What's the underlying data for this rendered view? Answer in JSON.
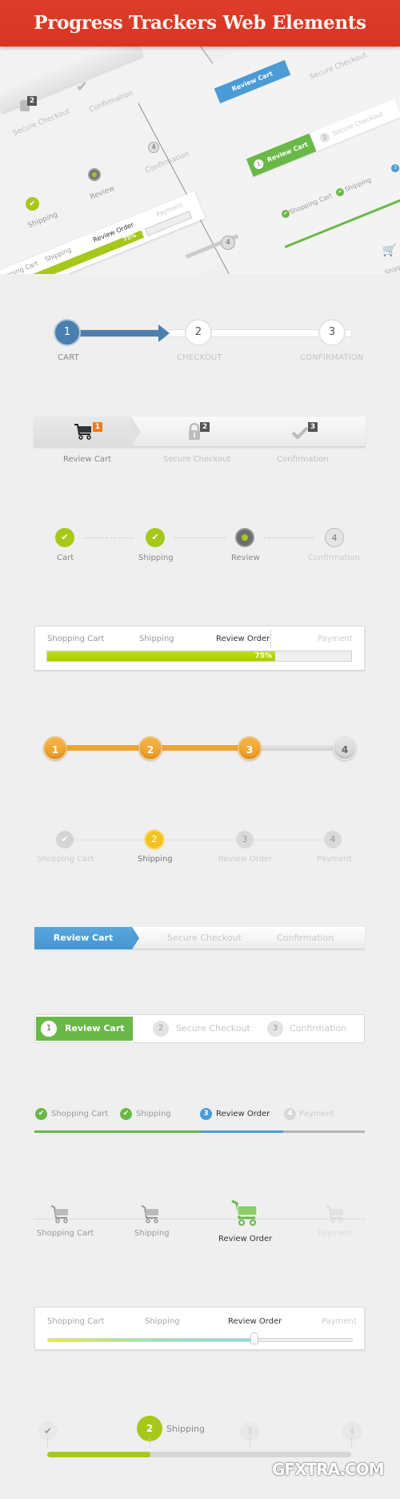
{
  "header": {
    "title": "Progress Trackers Web Elements"
  },
  "colors": {
    "header_red": "#d83424",
    "blue": "#4a7fb0",
    "lime": "#a6c81a",
    "orange": "#f0a22e",
    "yellow": "#f2c41f",
    "sky_blue": "#4a9bd6",
    "green": "#6ab848",
    "badge_orange": "#ef7d1a",
    "badge_dark": "#555555"
  },
  "hero": {
    "left_panel": {
      "secure_checkout": "Secure Checkout",
      "confirmation_top": "Confirmation",
      "confirmation": "Confirmation",
      "review": "Review",
      "shipping": "Shipping",
      "step4": "4",
      "badge2": "2",
      "bar_labels": [
        "Shopping Cart",
        "Shipping",
        "Review Order",
        "Payment"
      ],
      "bar_percent": "75%"
    },
    "right_panel": {
      "review_cart": "Review Cart",
      "secure": "Secure Checkout",
      "step1": "1",
      "step2": "2",
      "green_review_cart": "Review Cart",
      "shopping_cart": "Shopping Cart",
      "shipping": "Shipping",
      "step3": "3",
      "shipping_cart_label": "Shipping"
    }
  },
  "tracker_arrow": {
    "steps": [
      {
        "num": "1",
        "label": "CART",
        "state": "active"
      },
      {
        "num": "2",
        "label": "CHECKOUT",
        "state": "inactive"
      },
      {
        "num": "3",
        "label": "CONFIRMATION",
        "state": "inactive"
      }
    ]
  },
  "tracker_icons_bar": {
    "steps": [
      {
        "icon": "cart-icon",
        "badge": "1",
        "label": "Review Cart",
        "state": "active"
      },
      {
        "icon": "lock-icon",
        "badge": "2",
        "label": "Secure Checkout",
        "state": "inactive"
      },
      {
        "icon": "checkmark-icon",
        "badge": "3",
        "label": "Confirmation",
        "state": "inactive"
      }
    ]
  },
  "tracker_check_dots": {
    "steps": [
      {
        "label": "Cart",
        "state": "done"
      },
      {
        "label": "Shipping",
        "state": "done"
      },
      {
        "label": "Review",
        "state": "current"
      },
      {
        "num": "4",
        "label": "Confirmation",
        "state": "pending"
      }
    ]
  },
  "tracker_percent_bar": {
    "labels": [
      "Shopping Cart",
      "Shipping",
      "Review Order",
      "Payment"
    ],
    "progress": 0.75,
    "progress_label": "75%",
    "current_index": 2
  },
  "tracker_orange": {
    "steps": [
      "1",
      "2",
      "3",
      "4"
    ],
    "completed_count": 3
  },
  "tracker_yellow": {
    "steps": [
      {
        "label": "Shopping Cart",
        "state": "done"
      },
      {
        "num": "2",
        "label": "Shipping",
        "state": "current"
      },
      {
        "num": "3",
        "label": "Review Order",
        "state": "pending"
      },
      {
        "num": "4",
        "label": "Payment",
        "state": "pending"
      }
    ]
  },
  "tracker_blue_tabs": {
    "steps": [
      "Review Cart",
      "Secure Checkout",
      "Confirmation"
    ],
    "current_index": 0
  },
  "tracker_green_tabs": {
    "steps": [
      {
        "num": "1",
        "label": "Review Cart"
      },
      {
        "num": "2",
        "label": "Secure Checkout"
      },
      {
        "num": "3",
        "label": "Confirmation"
      }
    ],
    "current_index": 0
  },
  "tracker_underline": {
    "steps": [
      {
        "label": "Shopping Cart",
        "state": "done"
      },
      {
        "label": "Shipping",
        "state": "done"
      },
      {
        "num": "3",
        "label": "Review Order",
        "state": "current"
      },
      {
        "num": "4",
        "label": "Payment",
        "state": "pending"
      }
    ]
  },
  "tracker_carts": {
    "steps": [
      {
        "label": "Shopping Cart",
        "state": "done"
      },
      {
        "label": "Shipping",
        "state": "done"
      },
      {
        "label": "Review Order",
        "state": "current"
      },
      {
        "label": "Payment",
        "state": "pending"
      }
    ]
  },
  "tracker_slider": {
    "labels": [
      "Shopping Cart",
      "Shipping",
      "Review Order",
      "Payment"
    ],
    "progress": 0.68,
    "current_index": 2
  },
  "tracker_lime": {
    "steps": [
      {
        "num": "",
        "state": "done"
      },
      {
        "num": "2",
        "label": "Shipping",
        "state": "current"
      },
      {
        "num": "3",
        "state": "pending"
      },
      {
        "num": "4",
        "state": "pending"
      }
    ],
    "progress": 0.34
  },
  "watermark": {
    "text": "GFXTRA.COM"
  }
}
